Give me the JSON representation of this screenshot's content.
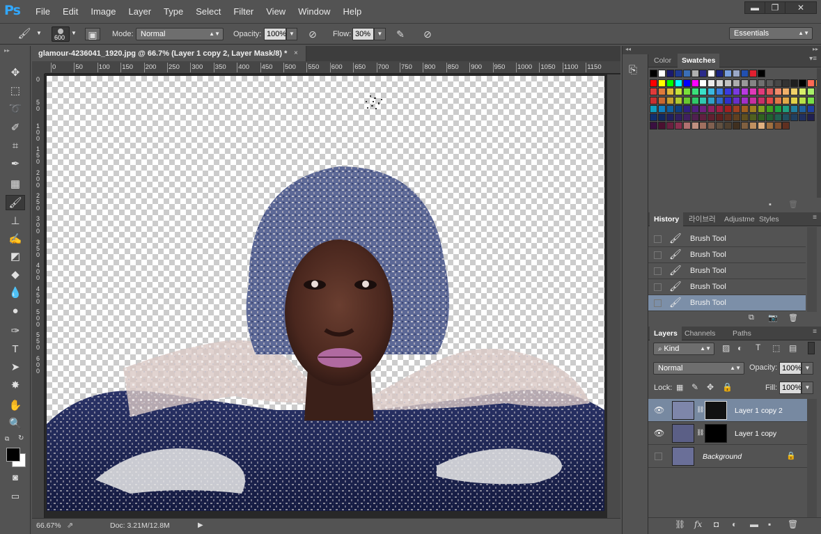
{
  "app": {
    "logo": "Ps"
  },
  "menu": [
    "File",
    "Edit",
    "Image",
    "Layer",
    "Type",
    "Select",
    "Filter",
    "View",
    "Window",
    "Help"
  ],
  "window_controls": {
    "minimize": "▬",
    "restore": "❐",
    "close": "✕"
  },
  "options_bar": {
    "brush_size": "600",
    "mode_label": "Mode:",
    "mode_value": "Normal",
    "opacity_label": "Opacity:",
    "opacity_value": "100%",
    "flow_label": "Flow:",
    "flow_value": "30%",
    "workspace": "Essentials"
  },
  "document": {
    "tab_title": "glamour-4236041_1920.jpg @ 66.7% (Layer 1 copy 2, Layer Mask/8) *",
    "close": "×",
    "ruler_h": [
      "0",
      "50",
      "100",
      "150",
      "200",
      "250",
      "300",
      "350",
      "400",
      "450",
      "500",
      "550",
      "600",
      "650",
      "700",
      "750",
      "800",
      "850",
      "900",
      "950",
      "1000",
      "1050",
      "1100",
      "1150"
    ],
    "ruler_v": [
      "0",
      "5\n0",
      "1\n0\n0",
      "1\n5\n0",
      "2\n0\n0",
      "2\n5\n0",
      "3\n0\n0",
      "3\n5\n0",
      "4\n0\n0",
      "4\n5\n0",
      "5\n0\n0",
      "5\n5\n0",
      "6\n0\n0"
    ],
    "zoom": "66.67%",
    "doc_info": "Doc: 3.21M/12.8M"
  },
  "colors": {
    "fg": "#000000",
    "bg": "#ffffff",
    "accent": "#7c8fa8"
  },
  "swatches_panel": {
    "tabs": [
      "Color",
      "Swatches"
    ],
    "active_tab": "Swatches"
  },
  "history_panel": {
    "tabs": [
      "History",
      "라이브러",
      "Adjustme",
      "Styles"
    ],
    "items": [
      "Brush Tool",
      "Brush Tool",
      "Brush Tool",
      "Brush Tool",
      "Brush Tool"
    ],
    "selected_index": 4
  },
  "layers_panel": {
    "tabs": [
      "Layers",
      "Channels",
      "Paths"
    ],
    "filter": "Kind",
    "blend_mode": "Normal",
    "opacity_label": "Opacity:",
    "opacity_value": "100%",
    "lock_label": "Lock:",
    "fill_label": "Fill:",
    "fill_value": "100%",
    "layers": [
      {
        "name": "Layer 1 copy 2",
        "visible": true,
        "selected": true
      },
      {
        "name": "Layer 1 copy",
        "visible": true,
        "selected": false
      },
      {
        "name": "Background",
        "visible": false,
        "selected": false
      }
    ]
  },
  "icons": [
    "move-icon",
    "marquee-icon",
    "lasso-icon",
    "quick-select-icon",
    "crop-icon",
    "eyedropper-icon",
    "healing-icon",
    "brush-icon",
    "stamp-icon",
    "history-brush-icon",
    "eraser-icon",
    "bucket-icon",
    "blur-icon",
    "dodge-icon",
    "pen-icon",
    "type-icon",
    "path-select-icon",
    "shape-icon",
    "hand-icon",
    "zoom-icon"
  ]
}
